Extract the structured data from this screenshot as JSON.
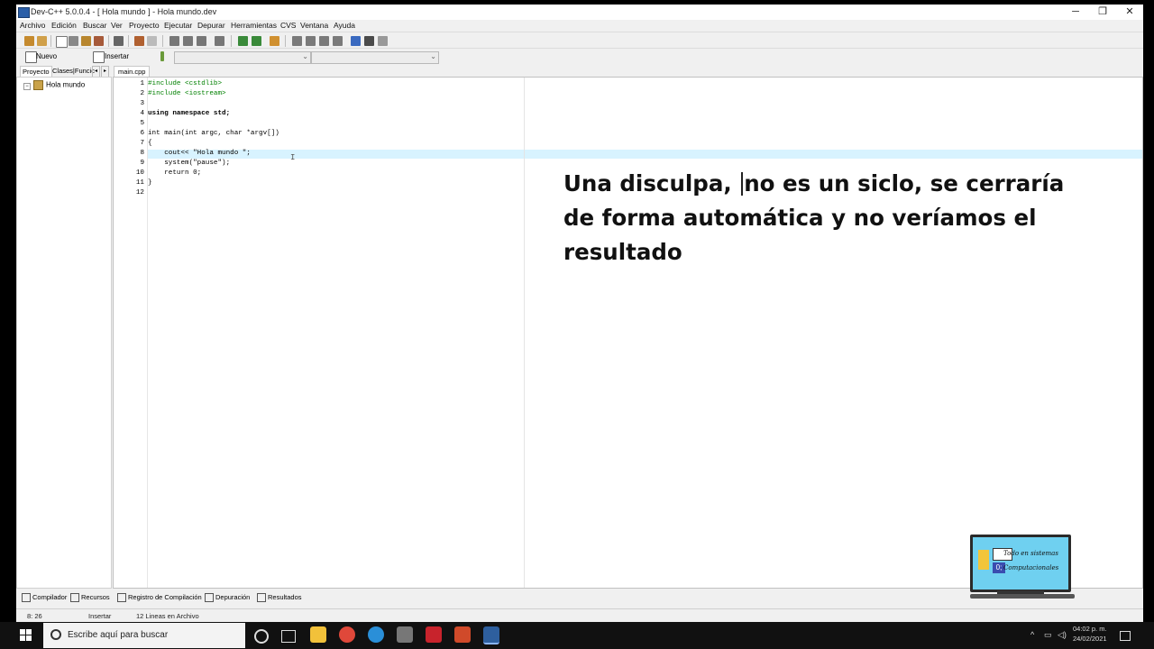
{
  "window": {
    "title": "Dev-C++ 5.0.0.4 - [ Hola mundo ] - Hola mundo.dev",
    "minimize": "─",
    "maximize": "❐",
    "close": "✕"
  },
  "menu": [
    "Archivo",
    "Edición",
    "Buscar",
    "Ver",
    "Proyecto",
    "Ejecutar",
    "Depurar",
    "Herramientas",
    "CVS",
    "Ventana",
    "Ayuda"
  ],
  "toolbar2": {
    "new_label": "Nuevo",
    "insert_label": "Insertar"
  },
  "left_tabs": {
    "project": "Proyecto",
    "classes": "Clases|Funcic"
  },
  "project_tree": {
    "item": "Hola mundo",
    "expander": "−"
  },
  "editor": {
    "tab": "main.cpp",
    "lines": [
      {
        "n": "1",
        "t": "#include <cstdlib>"
      },
      {
        "n": "2",
        "t": "#include <iostream>"
      },
      {
        "n": "3",
        "t": ""
      },
      {
        "n": "4",
        "t": "using namespace std;"
      },
      {
        "n": "5",
        "t": ""
      },
      {
        "n": "6",
        "t": "int main(int argc, char *argv[])"
      },
      {
        "n": "7",
        "t": "{"
      },
      {
        "n": "8",
        "t": "    cout<< \"Hola mundo \";"
      },
      {
        "n": "9",
        "t": "    system(\"pause\");"
      },
      {
        "n": "10",
        "t": "    return 0;"
      },
      {
        "n": "11",
        "t": "}"
      },
      {
        "n": "12",
        "t": ""
      }
    ]
  },
  "overlay": {
    "part1": "Una disculpa, ",
    "part2": "no es un siclo, se cerraría de forma automática y no veríamos el resultado"
  },
  "logo": {
    "line1": "Todo en sistemas",
    "line2": "Computacionales",
    "badge": "0;"
  },
  "bottom_tabs": [
    "Compilador",
    "Recursos",
    "Registro de Compilación",
    "Depuración",
    "Resultados"
  ],
  "status": {
    "position": "8: 26",
    "mode": "Insertar",
    "lines": "12 Lineas en Archivo"
  },
  "taskbar": {
    "search_placeholder": "Escribe aquí para buscar",
    "time": "04:02 p. m.",
    "date": "24/02/2021"
  }
}
